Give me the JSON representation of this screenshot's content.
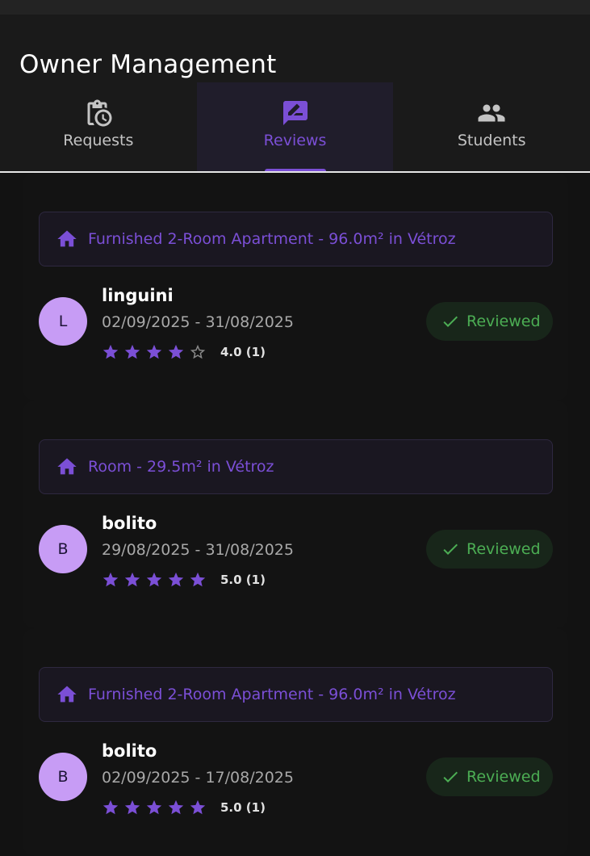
{
  "app": {
    "title": "Owner Management"
  },
  "tabs": [
    {
      "label": "Requests",
      "icon": "clipboard-clock-icon",
      "active": false
    },
    {
      "label": "Reviews",
      "icon": "rate-review-icon",
      "active": true
    },
    {
      "label": "Students",
      "icon": "people-icon",
      "active": false
    }
  ],
  "reviews": [
    {
      "property": "Furnished 2-Room Apartment - 96.0m² in Vétroz",
      "avatar_initial": "L",
      "name": "linguini",
      "dates": "02/09/2025 - 31/08/2025",
      "rating": 4,
      "rating_text": "4.0 (1)",
      "status": "Reviewed"
    },
    {
      "property": "Room - 29.5m² in Vétroz",
      "avatar_initial": "B",
      "name": "bolito",
      "dates": "29/08/2025 - 31/08/2025",
      "rating": 5,
      "rating_text": "5.0 (1)",
      "status": "Reviewed"
    },
    {
      "property": "Furnished 2-Room Apartment - 96.0m² in Vétroz",
      "avatar_initial": "B",
      "name": "bolito",
      "dates": "02/09/2025 - 17/08/2025",
      "rating": 5,
      "rating_text": "5.0 (1)",
      "status": "Reviewed"
    }
  ],
  "colors": {
    "accent": "#7b4fd6",
    "avatar": "#c79cf5",
    "reviewed": "#4cae54",
    "star_empty": "#8a8a8a"
  }
}
